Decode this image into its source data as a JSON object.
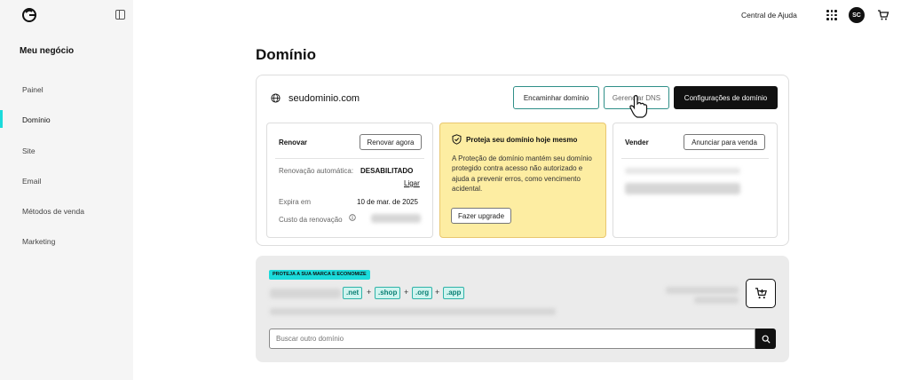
{
  "sidebar": {
    "title": "Meu negócio",
    "items": [
      {
        "label": "Painel"
      },
      {
        "label": "Domínio"
      },
      {
        "label": "Site"
      },
      {
        "label": "Email"
      },
      {
        "label": "Métodos de venda"
      },
      {
        "label": "Marketing"
      }
    ]
  },
  "header": {
    "help": "Central de Ajuda",
    "avatar_initials": "SC"
  },
  "page": {
    "title": "Domínio",
    "domain": "seudominio.com"
  },
  "actions": {
    "forward": "Encaminhar domínio",
    "dns": "Gerenciar DNS",
    "settings": "Configurações de domínio"
  },
  "renew": {
    "title": "Renovar",
    "button": "Renovar agora",
    "auto_label": "Renovação automática:",
    "auto_value": "DESABILITADO",
    "turn_on": "Ligar",
    "expires_label": "Expira em",
    "expires_value": "10 de mar. de 2025",
    "cost_label": "Custo da renovação"
  },
  "protect": {
    "title": "Proteja seu domínio hoje mesmo",
    "body": "A Proteção de domínio mantém seu domínio protegido contra acesso não autorizado e ajuda a prevenir erros, como vencimento acidental.",
    "button": "Fazer upgrade"
  },
  "sell": {
    "title": "Vender",
    "button": "Anunciar para venda"
  },
  "promo": {
    "tag": "PROTEJA A SUA MARCA E ECONOMIZE",
    "tlds": [
      ".net",
      ".shop",
      ".org",
      ".app"
    ],
    "search_placeholder": "Buscar outro domínio"
  },
  "colors": {
    "accent": "#1bdbdb",
    "protect_bg": "#fdeda2",
    "dark": "#111111"
  }
}
